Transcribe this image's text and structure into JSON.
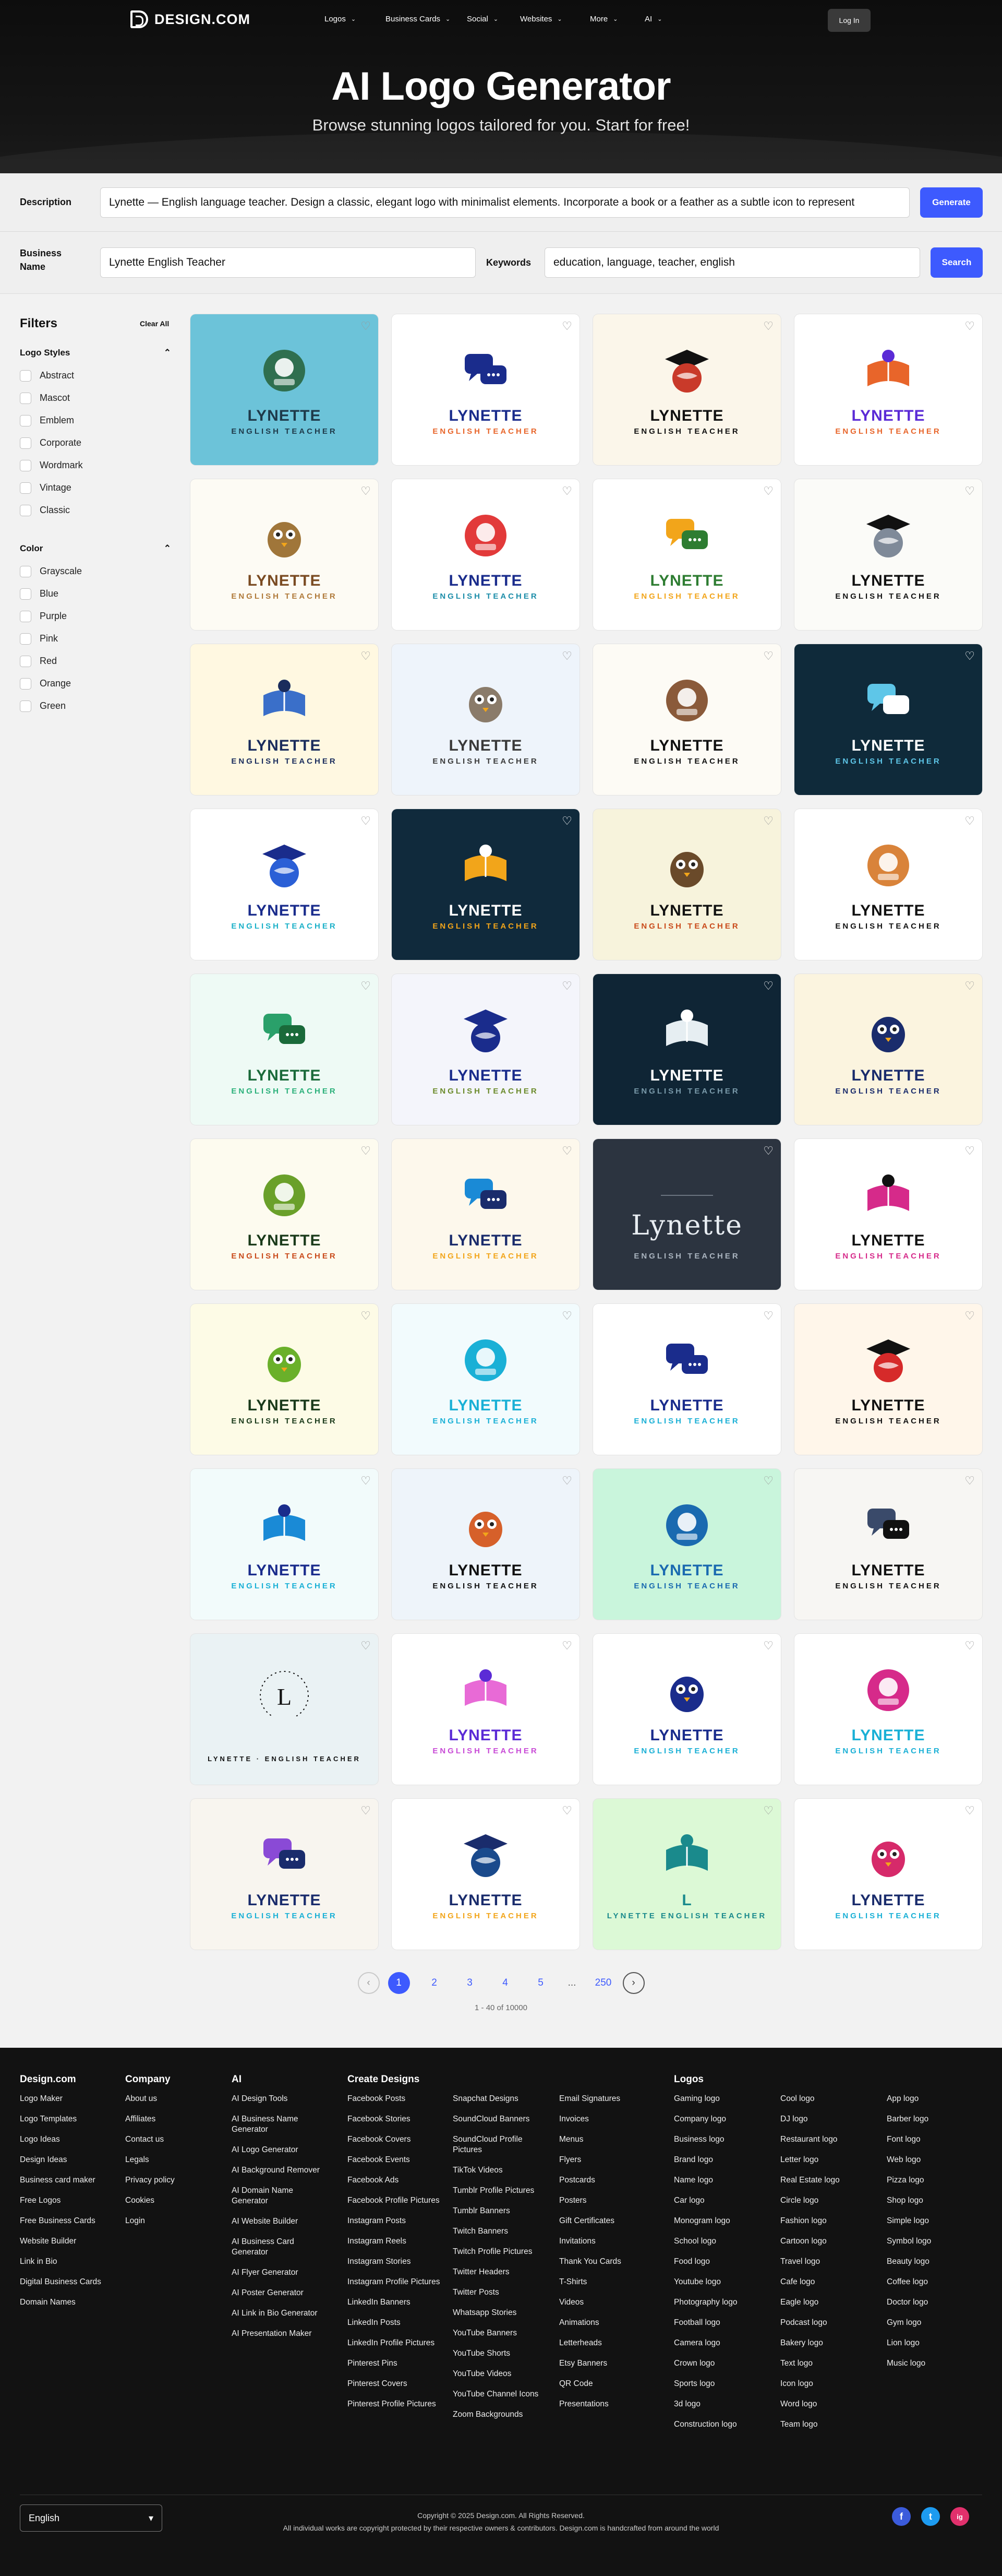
{
  "nav": {
    "brand": "DESIGN.COM",
    "items": [
      "Logos",
      "Business Cards",
      "Social",
      "Websites",
      "More",
      "AI"
    ],
    "login": "Log In"
  },
  "hero": {
    "title": "AI Logo Generator",
    "subtitle": "Browse stunning logos tailored for you. Start for free!"
  },
  "form": {
    "description_label": "Description",
    "description_value": "Lynette — English language teacher. Design a classic, elegant logo with minimalist elements. Incorporate a book or a feather as a subtle icon to represent",
    "generate": "Generate",
    "business_label_1": "Business",
    "business_label_2": "Name",
    "business_value": "Lynette English Teacher",
    "keywords_label": "Keywords",
    "keywords_value": "education, language, teacher, english",
    "search": "Search"
  },
  "filters": {
    "title": "Filters",
    "clear": "Clear All",
    "styles_title": "Logo Styles",
    "styles": [
      "Abstract",
      "Mascot",
      "Emblem",
      "Corporate",
      "Wordmark",
      "Vintage",
      "Classic"
    ],
    "color_title": "Color",
    "colors": [
      "Grayscale",
      "Blue",
      "Purple",
      "Pink",
      "Red",
      "Orange",
      "Green"
    ]
  },
  "cards": [
    {
      "bg": "#6cc3d9",
      "name": "LYNETTE",
      "tag": "ENGLISH TEACHER",
      "nc": "#1e3a4a",
      "tc": "#1e3a4a",
      "icon": "robot-teacher-icon",
      "ic": "#2f6f4f",
      "dark": false
    },
    {
      "bg": "#ffffff",
      "name": "LYNETTE",
      "tag": "ENGLISH TEACHER",
      "nc": "#1a2c8c",
      "tc": "#e8652a",
      "icon": "graduate-head-icon",
      "ic": "#1a2c8c",
      "dark": false
    },
    {
      "bg": "#fbf6ea",
      "name": "LYNETTE",
      "tag": "ENGLISH TEACHER",
      "nc": "#111111",
      "tc": "#111111",
      "icon": "teacher-mascot-icon",
      "ic": "#c93a2a",
      "dark": false
    },
    {
      "bg": "#ffffff",
      "name": "LYNETTE",
      "tag": "ENGLISH TEACHER",
      "nc": "#5b2bd6",
      "tc": "#e8652a",
      "icon": "speech-bubbles-icon",
      "ic": "#e8652a",
      "dark": false
    },
    {
      "bg": "#fdfbf4",
      "name": "LYNETTE",
      "tag": "ENGLISH TEACHER",
      "nc": "#7a4b22",
      "tc": "#b07a3a",
      "icon": "owl-icon",
      "ic": "#a0763a",
      "dark": false
    },
    {
      "bg": "#ffffff",
      "name": "LYNETTE",
      "tag": "ENGLISH TEACHER",
      "nc": "#1a2c8c",
      "tc": "#1a8ca8",
      "icon": "chat-person-icon",
      "ic": "#e23a3a",
      "dark": false
    },
    {
      "bg": "#ffffff",
      "name": "LYNETTE",
      "tag": "ENGLISH TEACHER",
      "nc": "#2e7d32",
      "tc": "#f2a51a",
      "icon": "open-book-globe-icon",
      "ic": "#f2a51a",
      "dark": false
    },
    {
      "bg": "#fbfbf8",
      "name": "LYNETTE",
      "tag": "ENGLISH TEACHER",
      "nc": "#111111",
      "tc": "#111111",
      "icon": "koala-icon",
      "ic": "#7f8a99",
      "dark": false
    },
    {
      "bg": "#fff8e1",
      "name": "LYNETTE",
      "tag": "ENGLISH TEACHER",
      "nc": "#1a2c5c",
      "tc": "#1a2c5c",
      "icon": "bird-teacher-icon",
      "ic": "#3a6fc9",
      "dark": false
    },
    {
      "bg": "#eef4fb",
      "name": "LYNETTE",
      "tag": "ENGLISH TEACHER",
      "nc": "#3a3a3a",
      "tc": "#3a3a3a",
      "icon": "owl-book-icon",
      "ic": "#8a7b6a",
      "dark": false
    },
    {
      "bg": "#fdfbf5",
      "name": "LYNETTE",
      "tag": "ENGLISH TEACHER",
      "nc": "#111111",
      "tc": "#111111",
      "icon": "bear-book-icon",
      "ic": "#8a5a3a",
      "dark": false
    },
    {
      "bg": "#0f2a3a",
      "name": "LYNETTE",
      "tag": "ENGLISH TEACHER",
      "nc": "#ffffff",
      "tc": "#5ec6e8",
      "icon": "head-chat-cap-icon",
      "ic": "#5ec6e8",
      "dark": true
    },
    {
      "bg": "#ffffff",
      "name": "LYNETTE",
      "tag": "ENGLISH TEACHER",
      "nc": "#1a2c8c",
      "tc": "#1ab0c8",
      "icon": "globe-chat-icon",
      "ic": "#2a5fd6",
      "dark": false
    },
    {
      "bg": "#102a3c",
      "name": "LYNETTE",
      "tag": "ENGLISH TEACHER",
      "nc": "#ffffff",
      "tc": "#f2a51a",
      "icon": "globe-book-icon",
      "ic": "#f2a51a",
      "dark": true
    },
    {
      "bg": "#f7f3dc",
      "name": "LYNETTE",
      "tag": "ENGLISH TEACHER",
      "nc": "#111111",
      "tc": "#c94a1a",
      "icon": "owl-cap-icon",
      "ic": "#6a4a2a",
      "dark": false
    },
    {
      "bg": "#ffffff",
      "name": "LYNETTE",
      "tag": "ENGLISH TEACHER",
      "nc": "#111111",
      "tc": "#111111",
      "icon": "teddy-bear-icon",
      "ic": "#d9833a",
      "dark": false
    },
    {
      "bg": "#eefaf5",
      "name": "LYNETTE",
      "tag": "ENGLISH TEACHER",
      "nc": "#1a6a3a",
      "tc": "#2ab07a",
      "icon": "globe-bubbles-icon",
      "ic": "#2aa06a",
      "dark": false
    },
    {
      "bg": "#f4f5fb",
      "name": "LYNETTE",
      "tag": "ENGLISH TEACHER",
      "nc": "#1a2c8c",
      "tc": "#6a8a2a",
      "icon": "cap-globe-icon",
      "ic": "#1a2c8c",
      "dark": false
    },
    {
      "bg": "#0f2535",
      "name": "LYNETTE",
      "tag": "ENGLISH TEACHER",
      "nc": "#ffffff",
      "tc": "#7a9aaa",
      "icon": "bird-chat-icon",
      "ic": "#e6eef2",
      "dark": true
    },
    {
      "bg": "#fbf4df",
      "name": "LYNETTE",
      "tag": "ENGLISH TEACHER",
      "nc": "#1a2c6c",
      "tc": "#1a2c6c",
      "icon": "teacher-portrait-seal-icon",
      "ic": "#1a2c6c",
      "dark": false
    },
    {
      "bg": "#fdfbef",
      "name": "LYNETTE",
      "tag": "ENGLISH TEACHER",
      "nc": "#1a3a1a",
      "tc": "#c94a1a",
      "icon": "double-bubble-icon",
      "ic": "#6aa02a",
      "dark": false
    },
    {
      "bg": "#fdf8ec",
      "name": "LYNETTE",
      "tag": "ENGLISH TEACHER",
      "nc": "#1a2c6c",
      "tc": "#f2a51a",
      "icon": "abc-bubble-icon",
      "ic": "#1a8ad6",
      "dark": false
    },
    {
      "bg": "#2c3440",
      "name": "Lynette",
      "tag": "ENGLISH TEACHER",
      "nc": "#e8edf2",
      "tc": "#aab4bf",
      "icon": "script-wordmark-icon",
      "ic": "#aab4bf",
      "dark": true
    },
    {
      "bg": "#ffffff",
      "name": "LYNETTE",
      "tag": "ENGLISH TEACHER",
      "nc": "#111111",
      "tc": "#d62a8a",
      "icon": "faces-profile-icon",
      "ic": "#d62a8a",
      "dark": false
    },
    {
      "bg": "#fdfbe6",
      "name": "LYNETTE",
      "tag": "ENGLISH TEACHER",
      "nc": "#1a3a1a",
      "tc": "#1a3a1a",
      "icon": "parrot-book-icon",
      "ic": "#6ab02a",
      "dark": false
    },
    {
      "bg": "#f2fbfd",
      "name": "LYNETTE",
      "tag": "ENGLISH TEACHER",
      "nc": "#1ab0d6",
      "tc": "#1ab0d6",
      "icon": "twin-bubbles-icon",
      "ic": "#1ab0d6",
      "dark": false
    },
    {
      "bg": "#ffffff",
      "name": "LYNETTE",
      "tag": "ENGLISH TEACHER",
      "nc": "#1a2c8c",
      "tc": "#1ab0d6",
      "icon": "globe-cap-book-icon",
      "ic": "#1a2c8c",
      "dark": false
    },
    {
      "bg": "#fff6ea",
      "name": "LYNETTE",
      "tag": "ENGLISH TEACHER",
      "nc": "#111111",
      "tc": "#111111",
      "icon": "apple-books-icon",
      "ic": "#d62a2a",
      "dark": false
    },
    {
      "bg": "#f2fbfb",
      "name": "LYNETTE",
      "tag": "ENGLISH TEACHER",
      "nc": "#1a2c8c",
      "tc": "#1ab0d6",
      "icon": "cap-bubble-icon",
      "ic": "#1a8ad6",
      "dark": false
    },
    {
      "bg": "#eef4fa",
      "name": "LYNETTE",
      "tag": "ENGLISH TEACHER",
      "nc": "#111111",
      "tc": "#111111",
      "icon": "school-supplies-icon",
      "ic": "#d6602a",
      "dark": false
    },
    {
      "bg": "#c9f5dc",
      "name": "LYNETTE",
      "tag": "ENGLISH TEACHER",
      "nc": "#1a6ab0",
      "tc": "#1a6ab0",
      "icon": "globe-stand-icon",
      "ic": "#1a6ab0",
      "dark": false
    },
    {
      "bg": "#f7f6f3",
      "name": "LYNETTE",
      "tag": "ENGLISH TEACHER",
      "nc": "#111111",
      "tc": "#111111",
      "icon": "professor-icon",
      "ic": "#3a4a6a",
      "dark": false
    },
    {
      "bg": "#eaf2f4",
      "name": "L",
      "tag": "LYNETTE · ENGLISH TEACHER",
      "nc": "#111111",
      "tc": "#111111",
      "icon": "circular-badge-icon",
      "ic": "#111111",
      "dark": false
    },
    {
      "bg": "#ffffff",
      "name": "LYNETTE",
      "tag": "ENGLISH TEACHER",
      "nc": "#5b2bd6",
      "tc": "#c84ad6",
      "icon": "chat-pages-icon",
      "ic": "#e86ad6",
      "dark": false
    },
    {
      "bg": "#ffffff",
      "name": "LYNETTE",
      "tag": "ENGLISH TEACHER",
      "nc": "#1a2c8c",
      "tc": "#1ab0d6",
      "icon": "globe-cap-icon",
      "ic": "#1a2c8c",
      "dark": false
    },
    {
      "bg": "#ffffff",
      "name": "LYNETTE",
      "tag": "ENGLISH TEACHER",
      "nc": "#1ab0d6",
      "tc": "#1ab0d6",
      "icon": "chat-pin-icon",
      "ic": "#d62a8a",
      "dark": false
    },
    {
      "bg": "#f8f5ef",
      "name": "LYNETTE",
      "tag": "ENGLISH TEACHER",
      "nc": "#1a2c6c",
      "tc": "#1ab0d6",
      "icon": "overlap-chat-icon",
      "ic": "#8a4ad6",
      "dark": false
    },
    {
      "bg": "#ffffff",
      "name": "LYNETTE",
      "tag": "ENGLISH TEACHER",
      "nc": "#1a2c6c",
      "tc": "#f2a51a",
      "icon": "globe-speech-icon",
      "ic": "#1a4a8c",
      "dark": false
    },
    {
      "bg": "#dcf9d6",
      "name": "L",
      "tag": "LYNETTE ENGLISH TEACHER",
      "nc": "#1a8a8c",
      "tc": "#1a8a8c",
      "icon": "monogram-icon",
      "ic": "#1a8a8c",
      "dark": false
    },
    {
      "bg": "#ffffff",
      "name": "LYNETTE",
      "tag": "ENGLISH TEACHER",
      "nc": "#1a2c6c",
      "tc": "#1ab0d6",
      "icon": "blob-chat-icon",
      "ic": "#d62a6a",
      "dark": false
    }
  ],
  "pagination": {
    "pages": [
      "1",
      "2",
      "3",
      "4",
      "5",
      "...",
      "250"
    ],
    "count": "1 - 40 of 10000",
    "prev": "‹",
    "next": "›"
  },
  "footer": {
    "columns": [
      {
        "title": "Design.com",
        "links": [
          "Logo Maker",
          "Logo Templates",
          "Logo Ideas",
          "Design Ideas",
          "Business card maker",
          "Free Logos",
          "Free Business Cards",
          "Website Builder",
          "Link in Bio",
          "Digital Business Cards",
          "Domain Names"
        ]
      },
      {
        "title": "Company",
        "links": [
          "About us",
          "Affiliates",
          "Contact us",
          "Legals",
          "Privacy policy",
          "Cookies",
          "Login"
        ]
      },
      {
        "title": "AI",
        "links": [
          "AI Design Tools",
          "AI Business Name Generator",
          "AI Logo Generator",
          "AI Background Remover",
          "AI Domain Name Generator",
          "AI Website Builder",
          "AI Business Card Generator",
          "AI Flyer Generator",
          "AI Poster Generator",
          "AI Link in Bio Generator",
          "AI Presentation Maker"
        ]
      },
      {
        "title": "Create Designs",
        "links": [
          "Facebook Posts",
          "Facebook Stories",
          "Facebook Covers",
          "Facebook Events",
          "Facebook Ads",
          "Facebook Profile Pictures",
          "Instagram Posts",
          "Instagram Reels",
          "Instagram Stories",
          "Instagram Profile Pictures",
          "LinkedIn Banners",
          "LinkedIn Posts",
          "LinkedIn Profile Pictures",
          "Pinterest Pins",
          "Pinterest Covers",
          "Pinterest Profile Pictures"
        ]
      },
      {
        "title": "",
        "links": [
          "Snapchat Designs",
          "SoundCloud Banners",
          "SoundCloud Profile Pictures",
          "TikTok Videos",
          "Tumblr Profile Pictures",
          "Tumblr Banners",
          "Twitch Banners",
          "Twitch Profile Pictures",
          "Twitter Headers",
          "Twitter Posts",
          "Whatsapp Stories",
          "YouTube Banners",
          "YouTube Shorts",
          "YouTube Videos",
          "YouTube Channel Icons",
          "Zoom Backgrounds"
        ]
      },
      {
        "title": "",
        "links": [
          "Email Signatures",
          "Invoices",
          "Menus",
          "Flyers",
          "Postcards",
          "Posters",
          "Gift Certificates",
          "Invitations",
          "Thank You Cards",
          "T-Shirts",
          "Videos",
          "Animations",
          "Letterheads",
          "Etsy Banners",
          "QR Code",
          "Presentations"
        ]
      },
      {
        "title": "Logos",
        "links": [
          "Gaming logo",
          "Company logo",
          "Business logo",
          "Brand logo",
          "Name logo",
          "Car logo",
          "Monogram logo",
          "School logo",
          "Food logo",
          "Youtube logo",
          "Photography logo",
          "Football logo",
          "Camera logo",
          "Crown logo",
          "Sports logo",
          "3d logo",
          "Construction logo"
        ]
      },
      {
        "title": "",
        "links": [
          "Cool logo",
          "DJ logo",
          "Restaurant logo",
          "Letter logo",
          "Real Estate logo",
          "Circle logo",
          "Fashion logo",
          "Cartoon logo",
          "Travel logo",
          "Cafe logo",
          "Eagle logo",
          "Podcast logo",
          "Bakery logo",
          "Text logo",
          "Icon logo",
          "Word logo",
          "Team logo"
        ]
      },
      {
        "title": "",
        "links": [
          "App logo",
          "Barber logo",
          "Font logo",
          "Web logo",
          "Pizza logo",
          "Shop logo",
          "Simple logo",
          "Symbol logo",
          "Beauty logo",
          "Coffee logo",
          "Doctor logo",
          "Gym logo",
          "Lion logo",
          "Music logo"
        ]
      }
    ],
    "language": "English",
    "copyright": "Copyright © 2025 Design.com. All Rights Reserved.",
    "notice": "All individual works are copyright protected by their respective owners & contributors. Design.com is handcrafted from around the world",
    "social": [
      "f",
      "t",
      "ig"
    ],
    "social_colors": [
      "#3b5bdb",
      "#1d9bf0",
      "#e1306c"
    ]
  }
}
